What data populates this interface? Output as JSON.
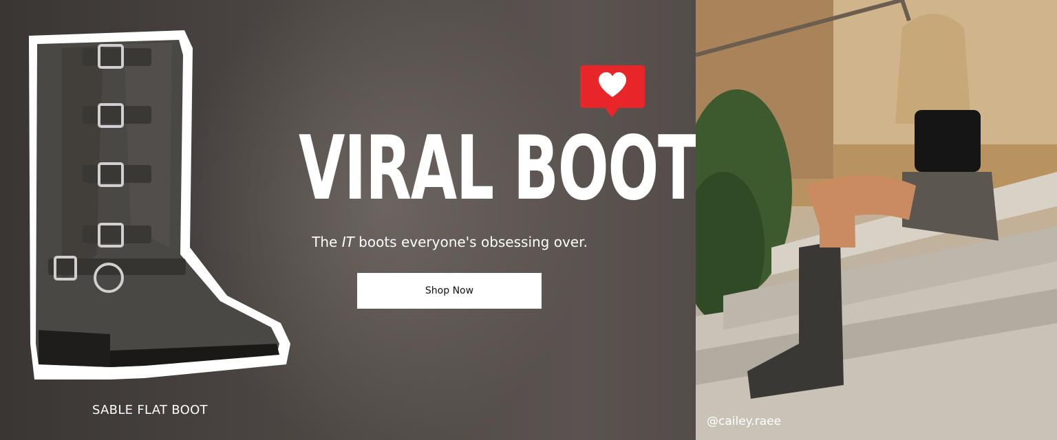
{
  "hero": {
    "headline": "VIRAL BOOTS",
    "subhead_prefix": "The ",
    "subhead_emphasis": "IT",
    "subhead_suffix": " boots everyone's obsessing over.",
    "cta_label": "Shop Now"
  },
  "product": {
    "name": "SABLE FLAT BOOT",
    "image": "distressed-grey-buckle-boot"
  },
  "lifestyle": {
    "handle": "@cailey.raee",
    "image": "woman-sitting-on-steps-wearing-boots"
  },
  "badge": {
    "icon": "heart-icon",
    "color": "#e8262a"
  },
  "colors": {
    "accent": "#e8262a",
    "button_bg": "#ffffff",
    "text": "#ffffff"
  }
}
